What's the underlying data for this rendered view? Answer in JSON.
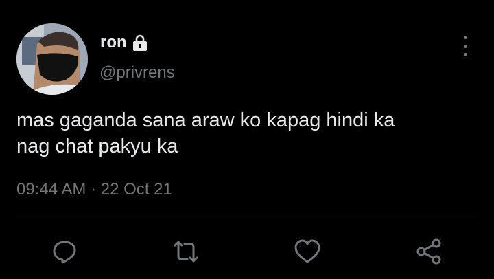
{
  "tweet": {
    "author_name": "ron",
    "author_handle": "@privrens",
    "protected_icon": "lock-icon",
    "text_line1": "mas gaganda sana araw ko kapag hindi ka",
    "text_line2": "nag chat pakyu ka",
    "time": "09:44 AM",
    "separator": "·",
    "date": "22 Oct 21"
  },
  "actions": [
    {
      "name": "reply",
      "icon": "speech-bubble-icon"
    },
    {
      "name": "retweet",
      "icon": "retweet-icon"
    },
    {
      "name": "like",
      "icon": "heart-icon"
    },
    {
      "name": "share",
      "icon": "share-icon"
    }
  ],
  "colors": {
    "background": "#000000",
    "primary_text": "#e7e9ea",
    "secondary_text": "#71767b",
    "divider": "#2f3336"
  }
}
